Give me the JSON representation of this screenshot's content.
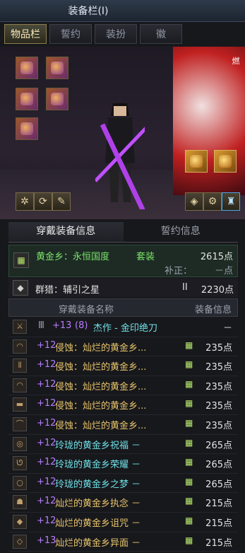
{
  "window": {
    "title": "装备栏(I)"
  },
  "tabs": [
    {
      "label": "物品栏"
    },
    {
      "label": "誓约"
    },
    {
      "label": "装扮"
    },
    {
      "label": "徽"
    }
  ],
  "scene": {
    "poster_text": "燃"
  },
  "info_tabs": [
    {
      "label": "穿戴装备信息"
    },
    {
      "label": "誓约信息"
    }
  ],
  "summary": {
    "set_name": "黄金乡：永恒国度",
    "set_suffix": "套装",
    "set_points": "2615点",
    "correction_label": "补正：",
    "correction_value": "－点",
    "second_name": "群猎：辅引之星",
    "second_roman": "II",
    "second_points": "2230点"
  },
  "table": {
    "col_name": "穿戴装备名称",
    "col_info": "装备信息",
    "rows": [
      {
        "icon": "sword-icon",
        "badge": "Ⅲ",
        "lvl": "+13",
        "enh": "(8)",
        "name": "杰作 - 金印绝刀",
        "pts": "－",
        "name_color": "cyan"
      },
      {
        "icon": "shoulder-icon",
        "lvl": "+12",
        "name": "侵蚀：灿烂的黄金乡...",
        "pts": "235点",
        "name_color": "gold"
      },
      {
        "icon": "pants-icon",
        "lvl": "+12",
        "name": "侵蚀：灿烂的黄金乡...",
        "pts": "235点",
        "name_color": "gold"
      },
      {
        "icon": "shoulder-icon",
        "lvl": "+12",
        "name": "侵蚀：灿烂的黄金乡...",
        "pts": "235点",
        "name_color": "gold"
      },
      {
        "icon": "belt-icon",
        "lvl": "+12",
        "name": "侵蚀：灿烂的黄金乡...",
        "pts": "235点",
        "name_color": "gold"
      },
      {
        "icon": "boots-icon",
        "lvl": "+12",
        "name": "侵蚀：灿烂的黄金乡...",
        "pts": "235点",
        "name_color": "gold"
      },
      {
        "icon": "bracelet-icon",
        "lvl": "+12",
        "name": "玲珑的黄金乡祝福 －",
        "pts": "265点",
        "name_color": "cyan"
      },
      {
        "icon": "necklace-icon",
        "lvl": "+12",
        "name": "玲珑的黄金乡荣耀 －",
        "pts": "265点",
        "name_color": "cyan"
      },
      {
        "icon": "ring-icon",
        "lvl": "+12",
        "name": "玲珑的黄金乡之梦 －",
        "pts": "265点",
        "name_color": "cyan"
      },
      {
        "icon": "support-icon",
        "lvl": "+12",
        "name": "灿烂的黄金乡执念 －",
        "pts": "215点",
        "name_color": "gold"
      },
      {
        "icon": "magic-stone-icon",
        "lvl": "+12",
        "name": "灿烂的黄金乡诅咒 －",
        "pts": "215点",
        "name_color": "gold"
      },
      {
        "icon": "earring-icon",
        "lvl": "+13",
        "name": "灿烂的黄金乡异面 －",
        "pts": "215点",
        "name_color": "gold"
      }
    ]
  },
  "colors": {
    "accent_gold": "#e9c56c",
    "set_green": "#7be36a",
    "epic_cyan": "#6fe0e6",
    "level_purple": "#b87cff"
  }
}
